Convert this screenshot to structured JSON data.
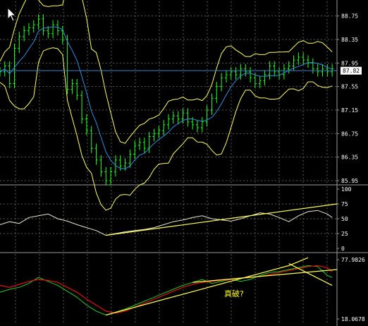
{
  "colors": {
    "background": "#000000",
    "grid": "#5a5a5a",
    "separator": "#9a9a9a",
    "candles": "#22ff22",
    "bollinger": "#ffff66",
    "ma": "#2f8fd8",
    "last_price_line": "#3a7fd0",
    "rsi": "#e8e8d0",
    "trendline": "#ffff55",
    "osc_green": "#22cc22",
    "osc_red": "#dd1111"
  },
  "main_panel": {
    "axis_ticks": [
      "88.75",
      "88.35",
      "87.95",
      "87.55",
      "87.15",
      "86.75",
      "86.35",
      "85.95"
    ],
    "last_price": "87.82"
  },
  "rsi_panel": {
    "axis_ticks": [
      "100",
      "75",
      "50",
      "25",
      "0"
    ]
  },
  "osc_panel": {
    "axis_ticks": [
      "77.9826",
      "18.0678"
    ],
    "annotation": "真破?"
  },
  "chart_data": [
    {
      "type": "line",
      "title": "",
      "ylim": [
        85.95,
        88.95
      ],
      "y_ticks": [
        88.75,
        88.35,
        87.95,
        87.55,
        87.15,
        86.75,
        86.35,
        85.95
      ],
      "last_price": 87.82,
      "x": [
        0,
        5,
        10,
        15,
        20,
        25,
        30,
        35,
        40,
        45,
        50,
        55,
        60,
        65,
        70,
        75,
        80,
        85,
        90,
        95,
        100,
        105,
        110,
        115,
        120,
        125,
        130,
        135,
        140,
        145,
        150,
        155,
        160,
        165,
        170,
        175,
        180,
        185,
        190,
        195,
        200,
        205,
        210,
        215,
        220,
        225,
        230,
        235,
        240,
        245,
        250,
        255,
        260,
        265,
        270,
        275,
        280,
        285,
        290,
        295,
        300,
        305,
        310,
        315,
        320,
        325,
        330,
        335,
        340,
        345
      ],
      "series": [
        {
          "values": [
            87.8,
            87.9,
            87.6,
            88.2,
            88.4,
            88.5,
            88.55,
            88.6,
            88.7,
            88.5,
            88.45,
            88.6,
            88.5,
            88.35,
            87.5,
            87.6,
            87.4,
            87.0,
            86.8,
            86.5,
            86.3,
            86.1,
            85.95,
            86.1,
            86.3,
            86.2,
            86.25,
            86.4,
            86.55,
            86.6,
            86.5,
            86.7,
            86.75,
            86.8,
            86.9,
            87.0,
            87.05,
            87.0,
            87.1,
            86.95,
            86.9,
            86.85,
            86.95,
            87.15,
            87.35,
            87.55,
            87.7,
            87.75,
            87.8,
            87.75,
            87.85,
            87.8,
            87.7,
            87.6,
            87.65,
            87.75,
            87.9,
            87.8,
            87.75,
            87.85,
            87.9,
            88.0,
            88.05,
            88.0,
            87.95,
            87.85,
            87.8,
            87.85,
            87.8,
            87.85
          ]
        }
      ]
    },
    {
      "type": "line",
      "title": "",
      "ylim": [
        0,
        100
      ],
      "y_ticks": [
        100,
        75,
        50,
        25,
        0
      ],
      "x": [
        0,
        10,
        20,
        30,
        40,
        50,
        60,
        70,
        80,
        90,
        100,
        110,
        120,
        130,
        140,
        150,
        160,
        170,
        180,
        190,
        200,
        210,
        220,
        230,
        240,
        250,
        260,
        270,
        280,
        290,
        300,
        310,
        320,
        330,
        340,
        345
      ],
      "series": [
        {
          "values": [
            40,
            45,
            42,
            52,
            55,
            58,
            50,
            46,
            40,
            35,
            30,
            22,
            25,
            28,
            30,
            32,
            35,
            40,
            45,
            48,
            52,
            55,
            50,
            48,
            46,
            50,
            55,
            60,
            58,
            52,
            45,
            55,
            62,
            64,
            58,
            52
          ]
        }
      ]
    },
    {
      "type": "line",
      "title": "",
      "ylim": [
        18.0678,
        77.9826
      ],
      "y_ticks": [
        77.9826,
        18.0678
      ],
      "x": [
        0,
        10,
        20,
        30,
        40,
        50,
        60,
        70,
        80,
        90,
        100,
        110,
        120,
        130,
        140,
        150,
        160,
        170,
        180,
        190,
        200,
        210,
        220,
        230,
        240,
        250,
        260,
        270,
        280,
        290,
        300,
        310,
        320,
        330,
        340,
        345
      ],
      "series": [
        {
          "values": [
            45,
            48,
            50,
            54,
            60,
            56,
            52,
            46,
            40,
            32,
            26,
            22,
            25,
            28,
            32,
            36,
            40,
            44,
            48,
            52,
            55,
            58,
            54,
            56,
            58,
            56,
            58,
            62,
            65,
            66,
            68,
            70,
            72,
            71,
            62,
            60
          ]
        },
        {
          "values": [
            52,
            50,
            53,
            56,
            58,
            57,
            55,
            50,
            45,
            38,
            32,
            26,
            24,
            26,
            30,
            34,
            38,
            42,
            46,
            50,
            53,
            55,
            56,
            57,
            58,
            59,
            60,
            61,
            63,
            65,
            67,
            69,
            71,
            72,
            70,
            66
          ]
        }
      ]
    }
  ]
}
